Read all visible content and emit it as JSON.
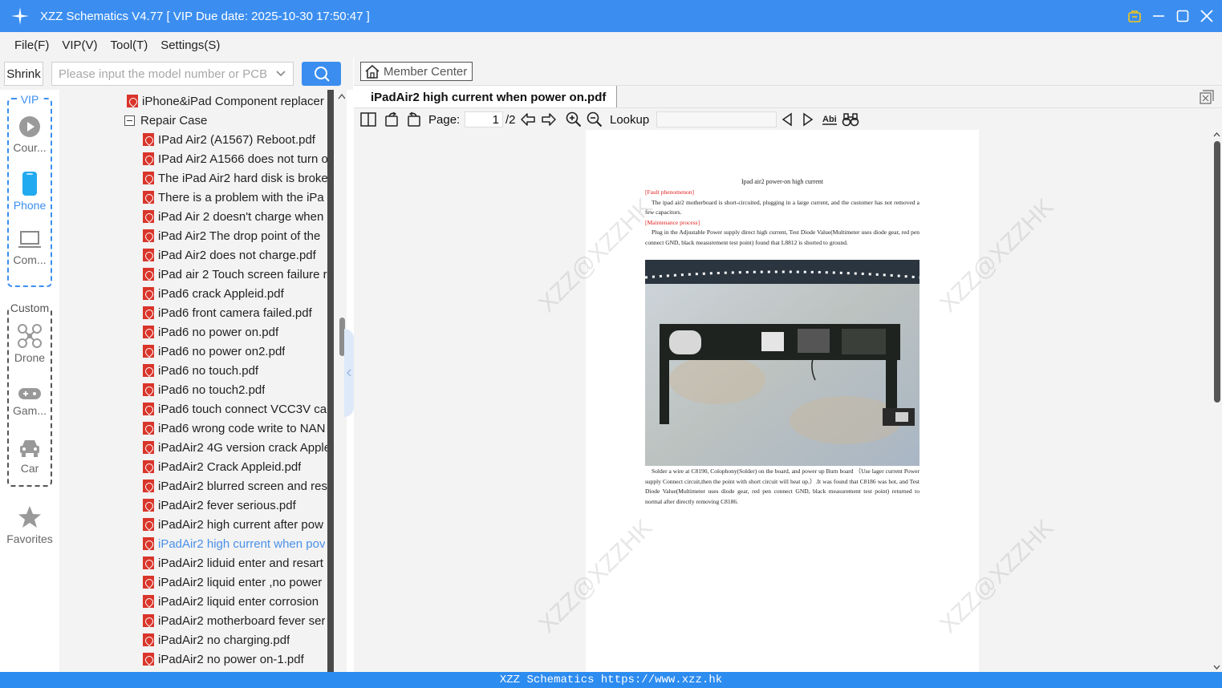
{
  "window": {
    "title": "XZZ Schematics V4.77 [ VIP Due date: 2025-10-30 17:50:47 ]"
  },
  "menu": [
    "File(F)",
    "VIP(V)",
    "Tool(T)",
    "Settings(S)"
  ],
  "search": {
    "shrink_label": "Shrink",
    "placeholder": "Please input the model number or PCB"
  },
  "categories": {
    "vip_label": "VIP",
    "custom_label": "Custom",
    "courses": "Cour...",
    "phone": "Phone",
    "computer": "Com...",
    "drone": "Drone",
    "games": "Gam...",
    "car": "Car",
    "favorites": "Favorites"
  },
  "tree": {
    "parent_item": "iPhone&iPad Component replacer",
    "folder": "Repair Case",
    "items": [
      "IPad Air2 (A1567) Reboot.pdf",
      "IPad Air2 A1566 does not turn o",
      "The iPad Air2 hard disk is broke",
      "There is a problem with the iPa",
      "iPad Air 2 doesn't charge when",
      "iPad Air2 The drop point of the",
      "iPad Air2 does not charge.pdf",
      "iPad air 2 Touch screen failure r",
      "iPad6 crack Appleid.pdf",
      "iPad6 front camera failed.pdf",
      "iPad6 no power on.pdf",
      "iPad6 no power on2.pdf",
      "iPad6 no touch.pdf",
      "iPad6 no touch2.pdf",
      "iPad6 touch connect VCC3V cap",
      "iPad6 wrong code write to NAN",
      "iPadAir2 4G version crack Apple",
      "iPadAir2 Crack Appleid.pdf",
      "iPadAir2 blurred screen and res",
      "iPadAir2 fever serious.pdf",
      "iPadAir2 high current after pow",
      "iPadAir2 high current when pov",
      "iPadAir2 liduid enter and resart",
      "iPadAir2 liquid enter ,no power",
      "iPadAir2 liquid enter corrosion",
      "iPadAir2 motherboard fever ser",
      "iPadAir2 no charging.pdf",
      "iPadAir2 no power on-1.pdf"
    ],
    "selected_index": 21
  },
  "viewer": {
    "member_center": "Member Center",
    "tab_title": "iPadAir2 high current when power on.pdf",
    "page_label": "Page:",
    "page_current": "1",
    "page_total": "/2",
    "lookup_label": "Lookup"
  },
  "document": {
    "title": "Ipad air2 power-on high current",
    "fault_heading": "[Fault phenomenon]",
    "fault_text": "The ipad air2 motherboard is short-circuited, plugging in a large current, and the customer has not removed a few capacitors.",
    "process_heading": "[Maintenance process]",
    "process_text": "Plug in the Adjustable Power supply direct high current, Test Diode Value(Multimeter uses diode gear, red pen connect GND, black measurement test point) found that L8812 is shorted to ground.",
    "after_text": "Solder a wire at C8190, Colophony(Solder) on the board, and power up Burn board （Use lager current Power supply Connect circuit,then the point with short circuit will heat up.）.It was found that C8186 was hot, and Test Diode Value(Multimeter uses diode gear, red pen connect GND, black measurement test point) returned to normal after directly removing C8186.",
    "watermark": "XZZ@XZZHK"
  },
  "statusbar": {
    "text": "XZZ Schematics https://www.xzz.hk"
  },
  "colors": {
    "accent": "#3b8ef0",
    "pdf_red": "#d9352b",
    "selected_text": "#4a90e8"
  }
}
